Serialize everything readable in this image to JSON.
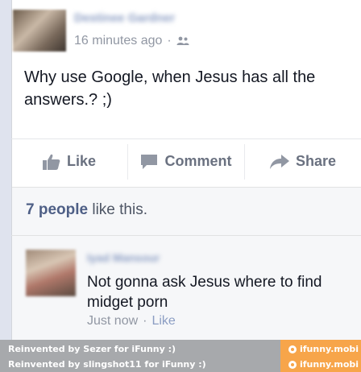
{
  "post": {
    "author_name": "Destinee Gardner",
    "timestamp": "16 minutes ago",
    "separator": "·",
    "audience_icon": "friends-icon",
    "text": "Why use Google, when Jesus has all the answers.? ;)"
  },
  "actions": {
    "like_label": "Like",
    "comment_label": "Comment",
    "share_label": "Share"
  },
  "likes": {
    "count_text": "7 people",
    "suffix": " like this."
  },
  "comment": {
    "author_name": "Iyad Mansour",
    "text": "Not gonna ask Jesus where to find midget porn",
    "timestamp": "Just now",
    "separator": "·",
    "like_label": "Like"
  },
  "footer": {
    "credit_1": "Reinvented by Sezer for iFunny :)",
    "credit_2": "Reinvented by slingshot11 for iFunny :)",
    "brand_1": "ifunny.mobi",
    "brand_2": "ifunny.mobi"
  },
  "colors": {
    "link_blue": "#4e5f86",
    "action_gray": "#6a7180",
    "footer_gray": "#a7a9ac",
    "brand_orange": "#f7a54a"
  }
}
